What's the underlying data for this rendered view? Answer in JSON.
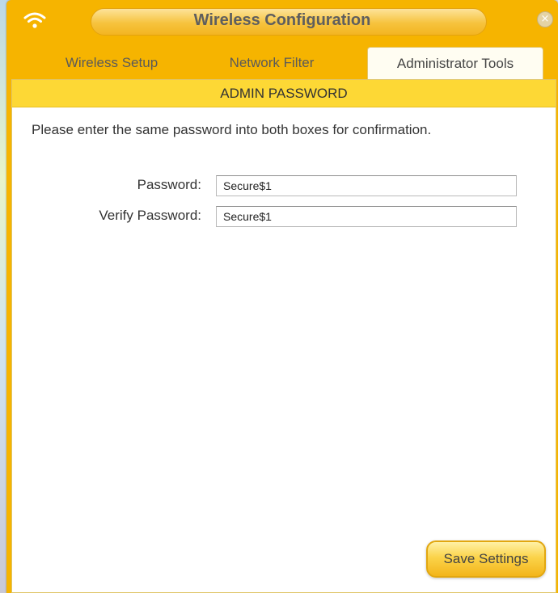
{
  "window": {
    "title": "Wireless Configuration",
    "close_glyph": "×"
  },
  "tabs": [
    {
      "label": "Wireless Setup",
      "active": false
    },
    {
      "label": "Network Filter",
      "active": false
    },
    {
      "label": "Administrator Tools",
      "active": true
    }
  ],
  "section": {
    "header": "ADMIN PASSWORD",
    "instructions": "Please enter the same password into both boxes for confirmation."
  },
  "form": {
    "password_label": "Password:",
    "password_value": "Secure$1",
    "verify_label": "Verify Password:",
    "verify_value": "Secure$1"
  },
  "actions": {
    "save_label": "Save Settings"
  },
  "colors": {
    "accent": "#f6b400",
    "header_band": "#fdd835",
    "button_border": "#e2a710"
  },
  "icons": [
    "wifi-icon",
    "close-icon"
  ]
}
